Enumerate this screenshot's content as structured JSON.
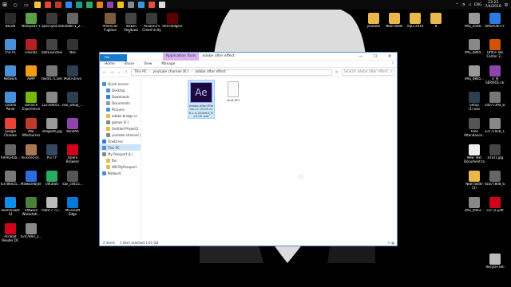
{
  "taskbar": {
    "apps": [
      {
        "name": "file-explorer",
        "color": "#f4c542"
      },
      {
        "name": "chrome",
        "color": "#e84335"
      },
      {
        "name": "app-red",
        "color": "#c0392b"
      },
      {
        "name": "app-blue",
        "color": "#2d89ef"
      },
      {
        "name": "app-teal",
        "color": "#16a085"
      },
      {
        "name": "app-green",
        "color": "#27ae60"
      },
      {
        "name": "app-orange",
        "color": "#e67e22"
      },
      {
        "name": "app-purple",
        "color": "#8e44ad"
      },
      {
        "name": "app-yellow",
        "color": "#f1c40f"
      },
      {
        "name": "app-gray",
        "color": "#7f8c8d"
      },
      {
        "name": "app-blue2",
        "color": "#3498db"
      },
      {
        "name": "app-red2",
        "color": "#e74c3c"
      },
      {
        "name": "app-white",
        "color": "#dddddd"
      }
    ],
    "lang": "ENG",
    "time": "23:23",
    "date": "7/4/2019"
  },
  "desktop_left": [
    {
      "label": "BEGIN",
      "color": "#2b2b2b"
    },
    {
      "label": "Notepad++",
      "color": "#5ba14a"
    },
    {
      "label": "Speccy64.exe",
      "color": "#3a3a3a"
    },
    {
      "label": "6360871_2...",
      "color": "#666666"
    },
    {
      "label": "This PC",
      "color": "#4a90d9"
    },
    {
      "label": "FileZilla",
      "color": "#b22222"
    },
    {
      "label": "BoltLauncher",
      "color": "#444444"
    },
    {
      "label": "Nox",
      "color": "#333333"
    },
    {
      "label": "Network",
      "color": "#4a90d9"
    },
    {
      "label": "AIMP",
      "color": "#f39c12"
    },
    {
      "label": "text01711ed...",
      "color": "#777777"
    },
    {
      "label": "Multi-Drive",
      "color": "#2c3e50"
    },
    {
      "label": "Control Panel",
      "color": "#4a90d9"
    },
    {
      "label": "GeForce Experience",
      "color": "#76b900"
    },
    {
      "label": "122784051...",
      "color": "#888888"
    },
    {
      "label": "nox_setup_...",
      "color": "#2c3e50"
    },
    {
      "label": "Google Chrome",
      "color": "#e84335"
    },
    {
      "label": "MSI Afterburner",
      "color": "#c0392b"
    },
    {
      "label": "image46.jpg",
      "color": "#999999"
    },
    {
      "label": "WinRAR",
      "color": "#8e44ad"
    },
    {
      "label": "timmy-bla...",
      "color": "#666666"
    },
    {
      "label": "muscles-of...",
      "color": "#aa7755"
    },
    {
      "label": "PuTTY",
      "color": "#34495e"
    },
    {
      "label": "Opera Browser",
      "color": "#d0021b"
    },
    {
      "label": "63786435...",
      "color": "#777777"
    },
    {
      "label": "Malwarebytes",
      "color": "#2d6cdf"
    },
    {
      "label": "UltraISO",
      "color": "#27ae60"
    },
    {
      "label": "kali_clt455...",
      "color": "#555555"
    },
    {
      "label": "TeamViewer 14",
      "color": "#0e8ee9"
    },
    {
      "label": "VMware Workstati...",
      "color": "#4c7e3c"
    },
    {
      "label": "Plate-7-71-...",
      "color": "#bbbbbb"
    },
    {
      "label": "Microsoft Edge",
      "color": "#0078d7"
    },
    {
      "label": "Acrobat Reader DC",
      "color": "#d0021b"
    },
    {
      "label": "8747893_2...",
      "color": "#888888"
    }
  ],
  "desktop_top": [
    {
      "label": "American Fugitive",
      "color": "#7a5c3a"
    },
    {
      "label": "Tekken Shadows D...",
      "color": "#444444"
    },
    {
      "label": "Assassin's Creed Unity",
      "color": "#3a3a3a"
    },
    {
      "label": "Red Rodgers",
      "color": "#5a0000"
    }
  ],
  "desktop_right_top": [
    {
      "label": "youtube",
      "color": "#e8b84a"
    },
    {
      "label": "New folder",
      "color": "#e8b84a"
    },
    {
      "label": "mp3 2019",
      "color": "#e8b84a"
    },
    {
      "label": "8",
      "color": "#e8b84a"
    }
  ],
  "desktop_right": [
    {
      "label": "IMG_0566...",
      "color": "#999999"
    },
    {
      "label": "KMSAuto++",
      "color": "#2c7be5"
    },
    {
      "label": "IMG_0894...",
      "color": "#888888"
    },
    {
      "label": "Office Tab Center 2...",
      "color": "#d35400"
    },
    {
      "label": "IMG_0865...",
      "color": "#999999"
    },
    {
      "label": "IT N SERVICE.rar",
      "color": "#8e44ad"
    },
    {
      "label": "Setup (1).exe",
      "color": "#2c3e50"
    },
    {
      "label": "24077394_8...",
      "color": "#777777"
    },
    {
      "label": "Time Attendance...",
      "color": "#555555"
    },
    {
      "label": "33771928_1...",
      "color": "#888888"
    },
    {
      "label": "New Text Document.txt",
      "color": "#eeeeee"
    },
    {
      "label": "10101.jpg",
      "color": "#444444"
    },
    {
      "label": "New folder (2)",
      "color": "#e8b84a"
    },
    {
      "label": "61877808_6...",
      "color": "#666666"
    },
    {
      "label": "IMG_0993...",
      "color": "#888888"
    },
    {
      "label": "ccc (2).pdf",
      "color": "#d0021b"
    },
    {
      "label": "Recycle Bin",
      "color": "#bbbbbb"
    }
  ],
  "window": {
    "context_tab": "Application Tools",
    "title": "adobe after effect",
    "quick_access": "▪ ▪ ▾ |",
    "ribbon_tabs": [
      "File",
      "Home",
      "Share",
      "View",
      "Manage"
    ],
    "breadcrumb": [
      "This PC",
      "youtube channel (K:)",
      "adobe after effect"
    ],
    "search_placeholder": "Search adobe after effect",
    "nav": [
      {
        "label": "Quick access",
        "level": 1,
        "color": "#4a90d9"
      },
      {
        "label": "Desktop",
        "level": 2,
        "color": "#4a90d9"
      },
      {
        "label": "Downloads",
        "level": 2,
        "color": "#2b7be0"
      },
      {
        "label": "Documents",
        "level": 2,
        "color": "#999999"
      },
      {
        "label": "Pictures",
        "level": 2,
        "color": "#4a90d9"
      },
      {
        "label": "adobe bridge cc",
        "level": 2,
        "color": "#e8b84a"
      },
      {
        "label": "games (F:)",
        "level": 2,
        "color": "#888888"
      },
      {
        "label": "Untitled Project2",
        "level": 2,
        "color": "#e8b84a"
      },
      {
        "label": "youtube channel (",
        "level": 2,
        "color": "#888888"
      },
      {
        "label": "OneDrive",
        "level": 1,
        "color": "#2b7be0"
      },
      {
        "label": "This PC",
        "level": 1,
        "color": "#4a90d9",
        "selected": true
      },
      {
        "label": "My Passport (J:)",
        "level": 1,
        "color": "#888888"
      },
      {
        "label": "fbn",
        "level": 2,
        "color": "#e8b84a"
      },
      {
        "label": "WD MyPassport",
        "level": 2,
        "color": "#e8b84a"
      },
      {
        "label": "Network",
        "level": 1,
        "color": "#4a90d9"
      }
    ],
    "files": [
      {
        "name": "Adobe.After.Effects.CC.2019.v16.1.0.204x64_FILE.OE.exe",
        "type": "ae",
        "icon_text": "Ae"
      },
      {
        "name": "stuff.JPG",
        "type": "jpg"
      }
    ],
    "status": {
      "items": "2 items",
      "selected": "1 item selected  1.61 GB"
    }
  }
}
